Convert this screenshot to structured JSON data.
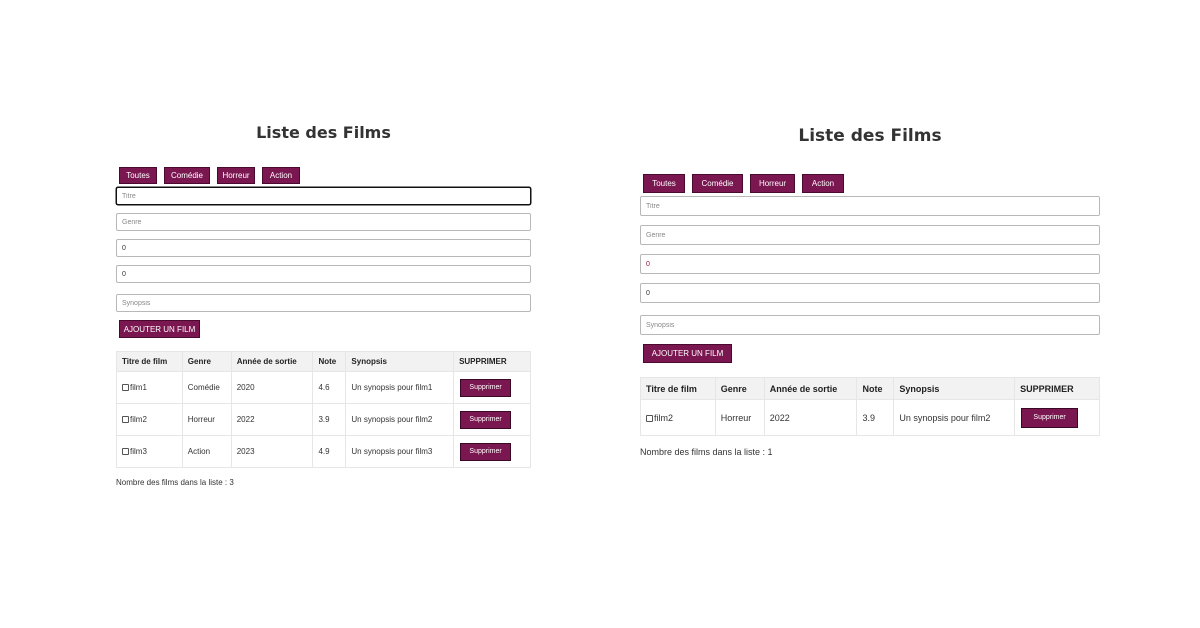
{
  "left": {
    "title": "Liste des Films",
    "filters": [
      "Toutes",
      "Comédie",
      "Horreur",
      "Action"
    ],
    "form": {
      "title_placeholder": "Titre",
      "genre_placeholder": "Genre",
      "year_value": "0",
      "rating_value": "0",
      "synopsis_placeholder": "Synopsis",
      "add_label": "AJOUTER UN FILM"
    },
    "table": {
      "headers": [
        "Titre de film",
        "Genre",
        "Année de sortie",
        "Note",
        "Synopsis",
        "SUPPRIMER"
      ],
      "rows": [
        {
          "title": "film1",
          "genre": "Comédie",
          "year": "2020",
          "rating": "4.6",
          "synopsis": "Un synopsis pour film1",
          "delete": "Supprimer"
        },
        {
          "title": "film2",
          "genre": "Horreur",
          "year": "2022",
          "rating": "3.9",
          "synopsis": "Un synopsis pour film2",
          "delete": "Supprimer"
        },
        {
          "title": "film3",
          "genre": "Action",
          "year": "2023",
          "rating": "4.9",
          "synopsis": "Un synopsis pour film3",
          "delete": "Supprimer"
        }
      ]
    },
    "count_text": "Nombre des films dans la liste : 3"
  },
  "right": {
    "title": "Liste des Films",
    "filters": [
      "Toutes",
      "Comédie",
      "Horreur",
      "Action"
    ],
    "form": {
      "title_placeholder": "Titre",
      "genre_placeholder": "Genre",
      "year_value": "0",
      "rating_value": "0",
      "synopsis_placeholder": "Synopsis",
      "add_label": "AJOUTER UN FILM"
    },
    "table": {
      "headers": [
        "Titre de film",
        "Genre",
        "Année de sortie",
        "Note",
        "Synopsis",
        "SUPPRIMER"
      ],
      "rows": [
        {
          "title": "film2",
          "genre": "Horreur",
          "year": "2022",
          "rating": "3.9",
          "synopsis": "Un synopsis pour film2",
          "delete": "Supprimer"
        }
      ]
    },
    "count_text": "Nombre des films dans la liste : 1"
  },
  "colors": {
    "button": "#7a1650",
    "header_bg": "#f2f2f2"
  }
}
